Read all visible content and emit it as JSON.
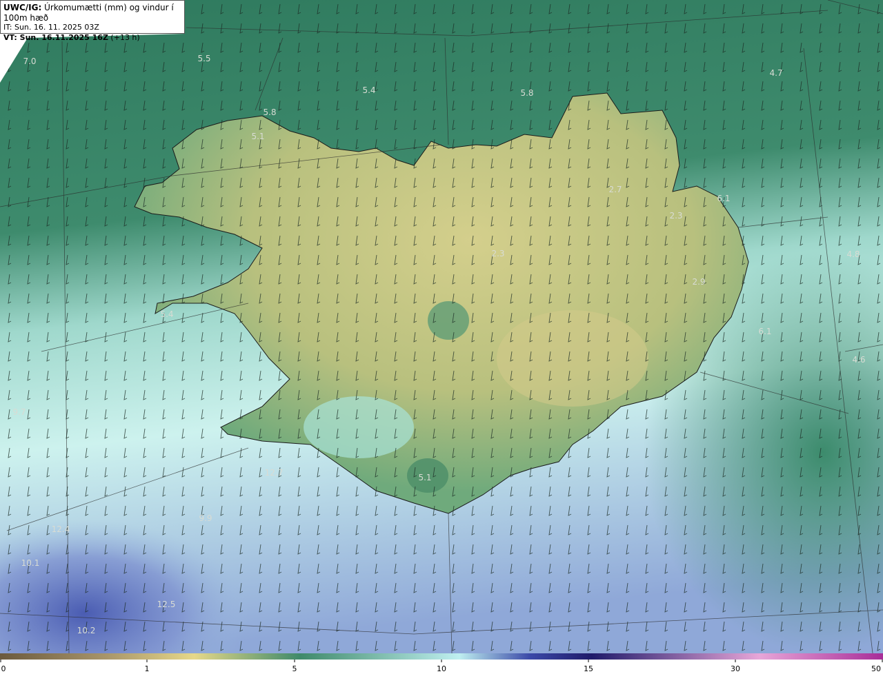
{
  "header": {
    "title_bold": "UWC/IG:",
    "title_rest": " Úrkomumætti (mm) og vindur í 100m hæð",
    "issue_time": "IT: Sun. 16. 11. 2025 03Z",
    "valid_bold": "VT: Sun. 16.11.2025 16Z",
    "valid_rest": " (+13 h)"
  },
  "colorbar": {
    "ticks": [
      "0",
      "1",
      "5",
      "10",
      "15",
      "30",
      "50"
    ],
    "colors": [
      "#6b5a3e",
      "#a8956a",
      "#e6d889",
      "#3f8a6a",
      "#bfeff0",
      "#3b49a8",
      "#1f1a6a",
      "#e7a6d8",
      "#a82d98"
    ]
  },
  "values": [
    "7.0",
    "5.5",
    "5.4",
    "5.8",
    "5.8",
    "4.7",
    "5.1",
    "2.7",
    "6.1",
    "2.3",
    "2.3",
    "4.8",
    "2.9",
    "5.4",
    "6.1",
    "4.6",
    "9.7",
    "12.7",
    "5.1",
    "9.9",
    "12.4",
    "10.1",
    "12.5",
    "10.2"
  ],
  "colors": {
    "sea_north": "#3d8a6c",
    "land": "#c9c98a",
    "sea_south": "#bdebe6",
    "sea_sw": "#5a6fb8"
  }
}
